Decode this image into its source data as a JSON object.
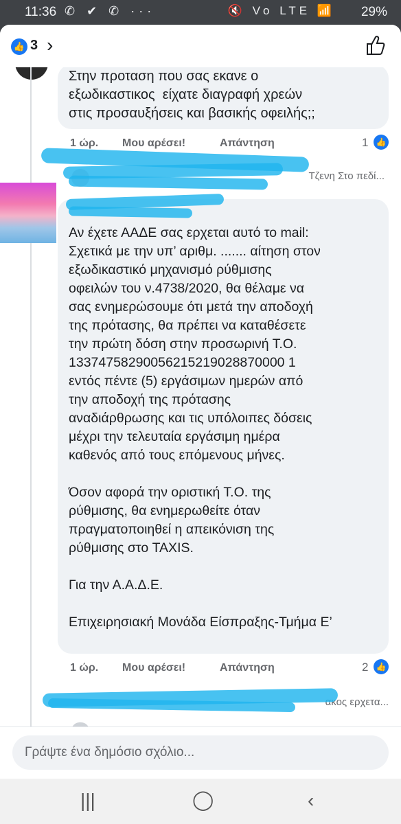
{
  "status_bar": {
    "time": "11:36",
    "left_icons": "✆ ✔ ✆ ···",
    "right_icons": "🔇 Vo LTE 📶",
    "battery": "29%"
  },
  "header": {
    "like_count": "3"
  },
  "comments": [
    {
      "text": "Στην προταση που σας εκανε ο\nεξωδικαστικος  είχατε διαγραφή χρεών\nστις προσαυξήσεις και βασικής οφειλής;;",
      "time": "1 ώρ.",
      "like_label": "Μου αρέσει!",
      "reply_label": "Απάντηση",
      "reaction_count": "1"
    },
    {
      "text": "Αν έχετε ΑΑΔΕ σας ερχεται αυτό το mail:\nΣχετικά με την υπ’ αριθμ. ....... αίτηση στον\nεξωδικαστικό μηχανισμό ρύθμισης\nοφειλών του ν.4738/2020, θα θέλαμε να\nσας ενημερώσουμε ότι μετά την αποδοχή\nτης πρότασης, θα πρέπει να καταθέσετε\nτην πρώτη δόση στην προσωρινή Τ.Ο.\n13374758290056215219028870000 1\nεντός πέντε (5) εργάσιμων ημερών από\nτην αποδοχή της πρότασης\nαναδιάρθρωσης και τις υπόλοιπες δόσεις\nμέχρι την τελευταία εργάσιμη ημέρα\nκαθενός από τους επόμενους μήνες.\n\nΌσον αφορά την οριστική Τ.Ο. της\nρύθμισης, θα ενημερωθείτε όταν\nπραγματοποιηθεί η απεικόνιση της\nρύθμισης στο TAXIS.\n\nΓια την Α.Α.Δ.Ε.\n\nΕπιχειρησιακή Μονάδα Είσπραξης-Τμήμα Ε’",
      "time": "1 ώρ.",
      "like_label": "Μου αρέσει!",
      "reply_label": "Απάντηση",
      "reaction_count": "2"
    }
  ],
  "reply_previews": [
    {
      "text": "Τζενη Στο πεδί..."
    },
    {
      "text": "ακος ερχετα..."
    }
  ],
  "composer": {
    "placeholder": "Γράψτε ένα δημόσιο σχόλιο..."
  },
  "colors": {
    "accent": "#1877f2",
    "bubble": "#eff2f5",
    "redaction": "#20b4ee"
  }
}
